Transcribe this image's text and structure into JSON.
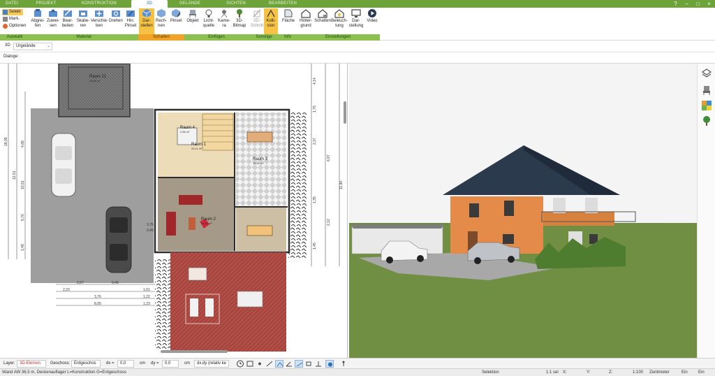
{
  "tabs": [
    "DATEI",
    "PROJEKT",
    "KONSTRUKTION",
    "3D",
    "GELÄNDE",
    "SICHTEN",
    "BEARBEITEN"
  ],
  "active_tab": "3D",
  "window_controls": [
    "help-icon",
    "minimize-icon",
    "maximize-icon",
    "close-icon"
  ],
  "ribbon": {
    "auswahl": {
      "selekt": "Selekt",
      "mark": "Mark.",
      "optionen": "Optionen"
    },
    "material": [
      "Abgrei-\nfen",
      "Zuwei-\nsen",
      "Bear-\nbeiten",
      "Skalie-\nren",
      "Verschie-\nben",
      "Drehen",
      "Hin.\nPinsel"
    ],
    "schatten": [
      "Dar-\nstellen",
      "Rech-\nnen",
      "Pinsel"
    ],
    "einfuegen": [
      "Objekt",
      "Licht-\nquelle",
      "Kame-\nra",
      "3D-\nBitmap"
    ],
    "sonstige": [
      "3D-\nSchnitt",
      "Kolli-\nsion"
    ],
    "info": [
      "Fläche"
    ],
    "einstellungen": [
      "Hinter-\ngrund",
      "Schatten",
      "Beleuch-\ntung",
      "Dar-\nstellung",
      "Video"
    ],
    "groups": [
      "Auswahl",
      "Material",
      "Schatten",
      "Einfügen",
      "Sonstige",
      "Info",
      "Einstellungen"
    ]
  },
  "subbar": {
    "view_label": "3D",
    "terrain_select": "Urgelände"
  },
  "dialog_label": "Dialoge:",
  "plan": {
    "rooms": [
      {
        "name": "Raum 21",
        "area": "25,65 m²"
      },
      {
        "name": "Raum 4",
        "area": "2,85 m²"
      },
      {
        "name": "Raum 1",
        "area": "20,11 m²"
      },
      {
        "name": "Raum 3",
        "area": "15,51 m²"
      },
      {
        "name": "Raum 2",
        "area": "26,85 m²"
      }
    ],
    "dims_left": [
      "18,05",
      "12,51",
      "4,89",
      "10,51",
      "5,76",
      "1,49"
    ],
    "dims_right": [
      "4,14",
      "1,75",
      "2,37",
      "6,97",
      "11,90",
      "1,35",
      "2,12",
      "1,45"
    ],
    "dims_bottom": [
      "2,57",
      "0,49",
      "2,23",
      "1,01",
      "3,76",
      "8,05",
      "1,22",
      "1,23"
    ],
    "dims_mid_left": [
      "3,76",
      "0,49"
    ]
  },
  "bottom_toolbar": {
    "layer_label": "Layer:",
    "layer_value": "3D-Elemen",
    "geschoss_label": "Geschoss:",
    "geschoss_value": "Erdgeschos",
    "dx_label": "dx =",
    "dx_value": "0,0",
    "dx_unit": "cm",
    "dy_label": "dy =",
    "dy_value": "0,0",
    "dy_unit": "cm",
    "mode_value": "dx,dy (relativ ke"
  },
  "status": {
    "message": "Wand AW 36,5 m, Deckenauflager L=Konstruktion G=Erdgeschoss",
    "selektion": "Selektion",
    "count": "1:1 sel",
    "x": "X:",
    "y": "Y:",
    "z": "Z:",
    "scale": "1:100",
    "unit": "Zentimeter",
    "ein": "Ein",
    "ein_value": "Ein"
  },
  "colors": {
    "accent_green": "#6ea33a",
    "ribbon_group": "#8cc152",
    "highlight": "#f5c243",
    "roof": "#2c3e50",
    "facade": "#e8954f",
    "grass": "#6a8a3a",
    "sky": "#f2f2f2"
  },
  "side_icons": [
    "layers-icon",
    "chair-icon",
    "palette-icon",
    "tree-icon"
  ]
}
